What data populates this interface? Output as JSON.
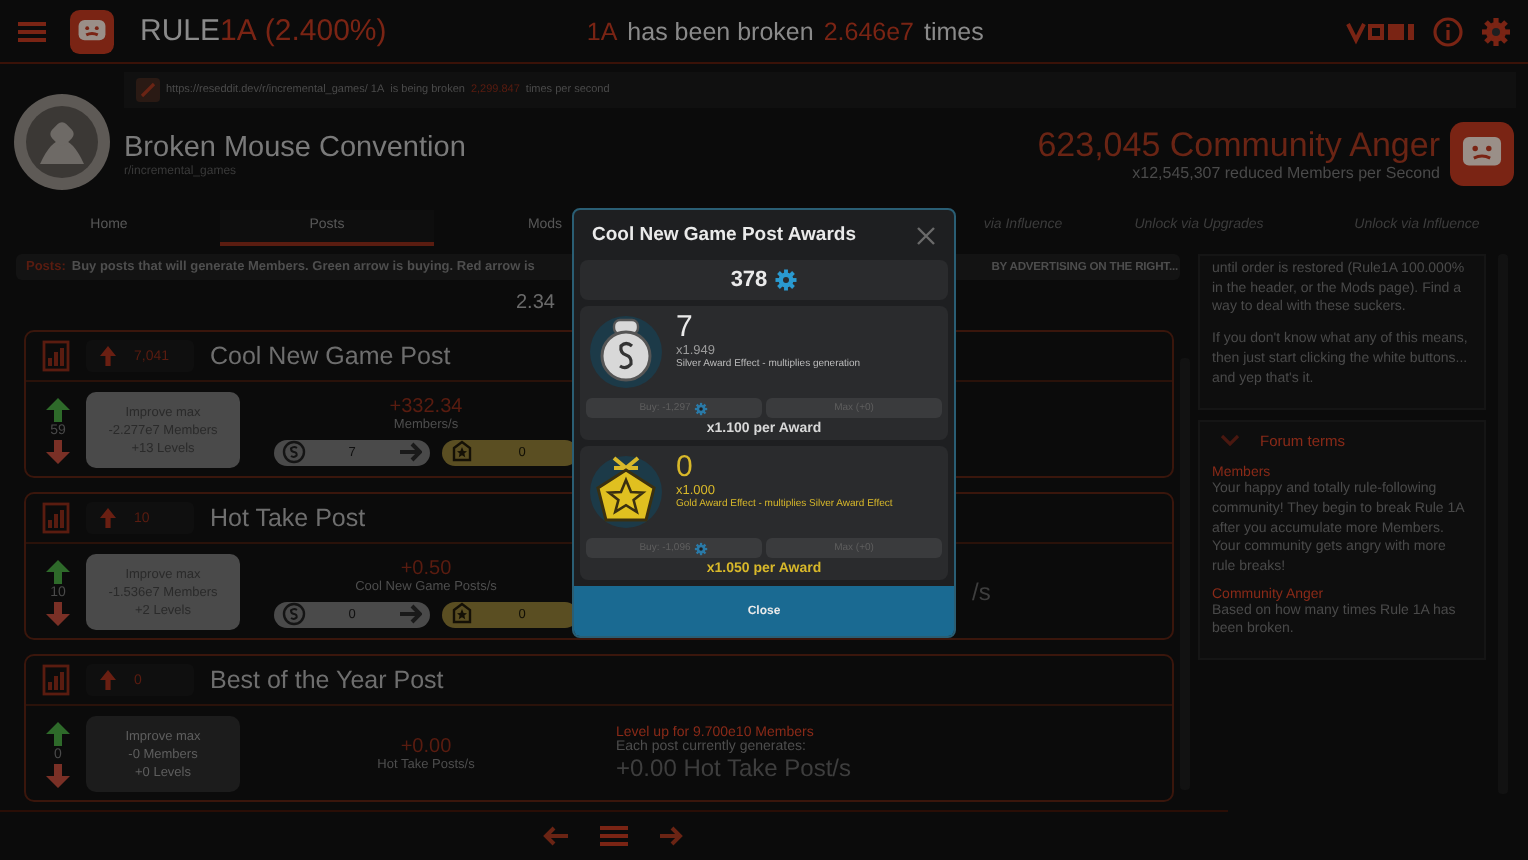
{
  "header": {
    "title": {
      "name": "RULE",
      "code": "1A",
      "percent": "(2.400%)"
    },
    "broken": {
      "code": "1A",
      "text": "has been broken",
      "count": "2.646e7",
      "suffix": "times"
    }
  },
  "community": {
    "url": "https://reseddit.dev/r/incremental_games/ 1A",
    "url_text": "is being broken",
    "rate": "2,299.847",
    "rate_suffix": "times per second",
    "name": "Broken Mouse Convention",
    "handle": "r/incremental_games",
    "anger": "623,045 Community Anger",
    "anger_note": "x12,545,307 reduced Members per Second"
  },
  "tabs": [
    {
      "label": "Home",
      "selected": false
    },
    {
      "label": "Posts",
      "selected": true
    },
    {
      "label": "Mods",
      "selected": false
    },
    {
      "label": "via Influence",
      "selected": false
    },
    {
      "label": "Unlock via Upgrades",
      "selected": false
    },
    {
      "label": "Unlock via Influence",
      "selected": false
    }
  ],
  "notice": {
    "label": "Posts:",
    "text_left": "Buy posts that will generate Members. Green arrow is buying. Red arrow is",
    "text_right": "BY ADVERTISING ON THE RIGHT..."
  },
  "total": "2.34",
  "posts": [
    {
      "count": "7,041",
      "title": "Cool New Game Post",
      "votes": "59",
      "improve": [
        "Improve max",
        "-2.277e7 Members",
        "+13 Levels"
      ],
      "improve_disabled": false,
      "gain": "+332.34",
      "gain_label": "Members/s",
      "silver": "7",
      "gold": "0"
    },
    {
      "count": "10",
      "title": "Hot Take Post",
      "votes": "10",
      "improve": [
        "Improve max",
        "-1.536e7 Members",
        "+2 Levels"
      ],
      "improve_disabled": false,
      "gain": "+0.50",
      "gain_label": "Cool New Game Posts/s",
      "silver": "0",
      "gold": "0",
      "side": [
        "/s"
      ]
    },
    {
      "count": "0",
      "title": "Best of the Year Post",
      "votes": "0",
      "improve": [
        "Improve max",
        "-0 Members",
        "+0 Levels"
      ],
      "improve_disabled": true,
      "gain": "+0.00",
      "gain_label": "Hot Take Posts/s",
      "side": [
        "Level up for 9.700e10 Members",
        "Each post currently generates:",
        "+0.00 Hot Take Post/s"
      ]
    }
  ],
  "sidebar": {
    "paragraphs": [
      "until order is restored (Rule1A 100.000% in the header, or the Mods page). Find a way to deal with these suckers.",
      "If you don't know what any of this means, then just start clicking the white buttons... and yep that's it."
    ],
    "section": {
      "title": "Forum terms",
      "expanded": true,
      "terms": [
        {
          "term": "Members",
          "text": "Your happy and totally rule-following community! They begin to break Rule 1A after you accumulate more Members. Your community gets angry with more rule breaks!"
        },
        {
          "term": "Community Anger",
          "text": "Based on how many times Rule 1A has been broken."
        }
      ]
    }
  },
  "modal": {
    "title": "Cool New Game Post Awards",
    "currency": "378",
    "awards": [
      {
        "kind": "silver",
        "count": "7",
        "multiplier": "x1.949",
        "effect": "Silver Award Effect - multiplies generation",
        "buy": "Buy: -1,297",
        "buy_disabled": true,
        "max": "Max (+0)",
        "per": "x1.100 per Award"
      },
      {
        "kind": "gold",
        "count": "0",
        "multiplier": "x1.000",
        "effect": "Gold Award Effect - multiplies Silver Award Effect",
        "buy": "Buy: -1,096",
        "buy_disabled": true,
        "max": "Max (+0)",
        "per": "x1.050 per Award"
      }
    ],
    "close": "Close"
  }
}
